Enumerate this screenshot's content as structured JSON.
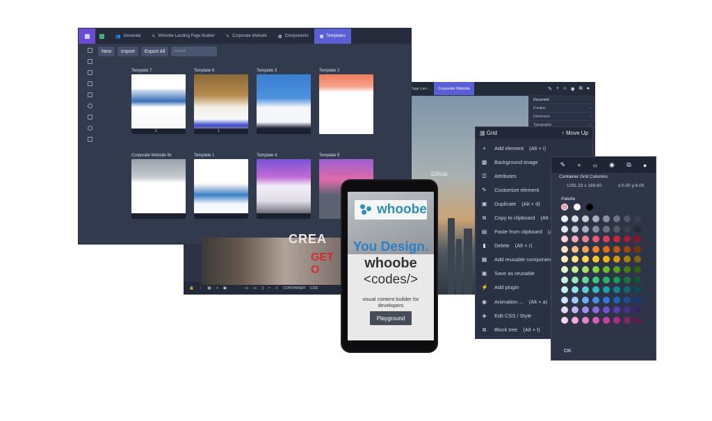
{
  "main_window": {
    "tabs": [
      {
        "label": ""
      },
      {
        "label": "Generate"
      },
      {
        "label": "Whoobe Landing Page Builder"
      },
      {
        "label": "Corporate Website"
      },
      {
        "label": "Components"
      },
      {
        "label": "Templates"
      }
    ],
    "toolbar": {
      "new": "New",
      "import": "Import",
      "export": "Export All",
      "search_placeholder": "search"
    },
    "templates": [
      {
        "name": "Template 7",
        "num": "2"
      },
      {
        "name": "Template 6",
        "num": "1"
      },
      {
        "name": "Template 3",
        "num": ""
      },
      {
        "name": "Template 2",
        "num": ""
      },
      {
        "name": "Corporate Website 9c",
        "num": ""
      },
      {
        "name": "Template 1",
        "num": ""
      },
      {
        "name": "Template 4",
        "num": ""
      },
      {
        "name": "Template 5",
        "num": ""
      }
    ]
  },
  "editor": {
    "tabs": [
      {
        "label": "Page Lan..."
      },
      {
        "label": "Corporate Website"
      }
    ],
    "doc_panel": {
      "title": "Document",
      "rows": [
        "Position",
        "Dimension",
        "Typography"
      ]
    },
    "canvas_text": "Github",
    "bottom": {
      "container": "CONTAINER",
      "css": "CSS"
    },
    "collage": {
      "t1": "CREA",
      "t2": "GET O"
    }
  },
  "context_menu": {
    "title": "Grid",
    "move_up": "Move Up",
    "items": [
      {
        "icon": "plus-icon",
        "label": "Add element",
        "shortcut": "(Alt + i)"
      },
      {
        "icon": "image-icon",
        "label": "Background image",
        "shortcut": ""
      },
      {
        "icon": "list-icon",
        "label": "Attributes",
        "shortcut": ""
      },
      {
        "icon": "brush-icon",
        "label": "Customize element",
        "shortcut": ""
      },
      {
        "icon": "duplicate-icon",
        "label": "Duplicate",
        "shortcut": "(Alt + d)"
      },
      {
        "icon": "copy-icon",
        "label": "Copy to clipboard",
        "shortcut": "(Alt + c)"
      },
      {
        "icon": "paste-icon",
        "label": "Paste from clipboard",
        "shortcut": "(Alt"
      },
      {
        "icon": "trash-icon",
        "label": "Delete",
        "shortcut": "(Alt + r)"
      },
      {
        "icon": "grid-icon",
        "label": "Add reusable component",
        "shortcut": ""
      },
      {
        "icon": "save-icon",
        "label": "Save as reusable",
        "shortcut": ""
      },
      {
        "icon": "plugin-icon",
        "label": "Add plugin",
        "shortcut": ""
      },
      {
        "icon": "animation-icon",
        "label": "Animation ...",
        "shortcut": "(Alt + a)"
      },
      {
        "icon": "css-icon",
        "label": "Edit CSS / Style",
        "shortcut": ""
      },
      {
        "icon": "tree-icon",
        "label": "Block tree",
        "shortcut": "(Alt + t)"
      }
    ]
  },
  "palette_panel": {
    "title": "Container Grid Columns",
    "dims": "1291.33 x 169.60",
    "coords": "x:0.00 y:8.00",
    "palette_label": "Palette",
    "ok": "OK",
    "colors": [
      [
        "#f2f2f2",
        "#d9dce3",
        "#c7cbd3",
        "#aab0bb",
        "#8a92a0",
        "#6b7383",
        "#4d5566",
        "#354052"
      ],
      [
        "#e8e8e8",
        "#c5ccd6",
        "#a7afbb",
        "#878f9c",
        "#6d7480",
        "#535a65",
        "#3b4049",
        "#262a31"
      ],
      [
        "#f7d0d8",
        "#f3a9b7",
        "#ee8095",
        "#e85a73",
        "#e33a57",
        "#c8283f",
        "#a81d31",
        "#871526"
      ],
      [
        "#fde0c4",
        "#fbc08a",
        "#f8a155",
        "#f48424",
        "#e46c12",
        "#c0590b",
        "#9b4809",
        "#7a3706"
      ],
      [
        "#fff3bf",
        "#ffe58a",
        "#ffd656",
        "#fcc52a",
        "#f4b512",
        "#d69c0a",
        "#b07f08",
        "#8a6306"
      ],
      [
        "#dff7c8",
        "#c2ee95",
        "#a4e366",
        "#86d43e",
        "#6cc023",
        "#56a319",
        "#418112",
        "#2f620c"
      ],
      [
        "#cdf4de",
        "#99e8bd",
        "#66d99c",
        "#3ec97d",
        "#25b565",
        "#1b9753",
        "#137741",
        "#0d5a31"
      ],
      [
        "#c9f1f3",
        "#94e2e8",
        "#5ecfd8",
        "#33bac6",
        "#1aa2b0",
        "#12868f",
        "#0d6a72",
        "#094f55"
      ],
      [
        "#cfe4fb",
        "#a0c9f6",
        "#70acef",
        "#4891e6",
        "#2b79d8",
        "#1f62b8",
        "#184e94",
        "#113a70"
      ],
      [
        "#e1d9fb",
        "#c3b3f5",
        "#a48dee",
        "#8a6be3",
        "#7250d4",
        "#5c3db5",
        "#482f91",
        "#35226d"
      ],
      [
        "#f6d6ef",
        "#eeadde",
        "#e583cb",
        "#d85eb6",
        "#c6409e",
        "#a62f83",
        "#852467",
        "#63194c"
      ]
    ]
  },
  "phone": {
    "logo": "whoobe",
    "line1": "You Design.",
    "line2": "whoobe",
    "line3": "<codes/>",
    "subtitle": "visual content builder for developers",
    "button": "Playground"
  }
}
